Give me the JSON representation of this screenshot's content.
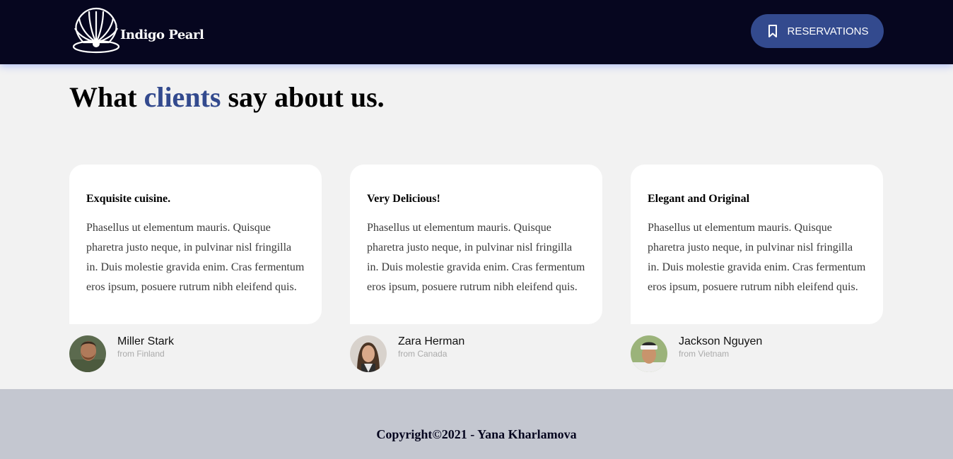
{
  "header": {
    "brand": "Indigo Pearl",
    "reservations_label": "RESERVATIONS",
    "logo_icon": "shell-icon",
    "button_icon": "bookmark-icon",
    "bg_color": "#06061f",
    "accent_color": "#334a8e"
  },
  "section": {
    "title_before": "What",
    "title_accent": "clients",
    "title_after": "say about us."
  },
  "testimonials": [
    {
      "title": "Exquisite cuisine.",
      "text": "Phasellus ut elementum mauris. Quisque pharetra justo neque, in pulvinar nisl fringilla in. Duis molestie gravida enim. Cras fermentum eros ipsum, posuere rutrum nibh eleifend quis.",
      "name": "Miller Stark",
      "origin": "from Finland"
    },
    {
      "title": "Very Delicious!",
      "text": "Phasellus ut elementum mauris. Quisque pharetra justo neque, in pulvinar nisl fringilla in. Duis molestie gravida enim. Cras fermentum eros ipsum, posuere rutrum nibh eleifend quis.",
      "name": "Zara Herman",
      "origin": "from Canada"
    },
    {
      "title": "Elegant and Original",
      "text": "Phasellus ut elementum mauris. Quisque pharetra justo neque, in pulvinar nisl fringilla in. Duis molestie gravida enim. Cras fermentum eros ipsum, posuere rutrum nibh eleifend quis.",
      "name": "Jackson Nguyen",
      "origin": "from Vietnam"
    }
  ],
  "footer": {
    "copyright": "Copyright©2021 - Yana Kharlamova",
    "bg_color": "#c4c7d0"
  }
}
